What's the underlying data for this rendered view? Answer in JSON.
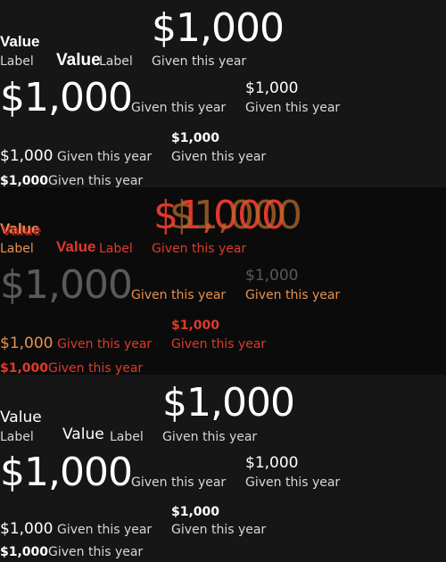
{
  "stat": {
    "value": "$1,000",
    "given_label": "Given this year",
    "value_word": "Value",
    "label_word": "Label"
  },
  "colors": {
    "background": "#161616",
    "overlay_background": "#0b0b0b",
    "text": "#ffffff",
    "label": "#d8d8d8",
    "accent_red": "#e0392b",
    "accent_orange": "#e89050"
  }
}
